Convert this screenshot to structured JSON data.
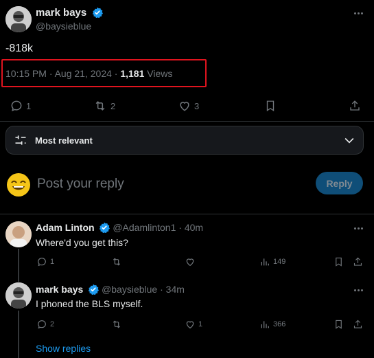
{
  "tweet": {
    "author_name": "mark bays",
    "author_handle": "@baysieblue",
    "text": "-818k",
    "timestamp": "10:15 PM · Aug 21, 2024 · ",
    "views_count": "1,181",
    "views_label": " Views",
    "actions": {
      "replies": "1",
      "retweets": "2",
      "likes": "3"
    }
  },
  "sort": {
    "label": "Most relevant"
  },
  "compose": {
    "placeholder": "Post your reply",
    "button_label": "Reply"
  },
  "replies": [
    {
      "author_name": "Adam Linton",
      "author_handle": "@Adamlinton1",
      "time": " · 40m",
      "text": "Where'd you get this?",
      "actions": {
        "replies": "1",
        "retweets": "",
        "likes": "",
        "views": "149"
      }
    },
    {
      "author_name": "mark bays",
      "author_handle": "@baysieblue",
      "time": " · 34m",
      "text": "I phoned the BLS myself.",
      "actions": {
        "replies": "2",
        "retweets": "",
        "likes": "1",
        "views": "366"
      }
    }
  ],
  "show_replies": "Show replies",
  "colors": {
    "accent": "#1d9bf0",
    "highlight": "#e0141e",
    "muted": "#71767b"
  }
}
